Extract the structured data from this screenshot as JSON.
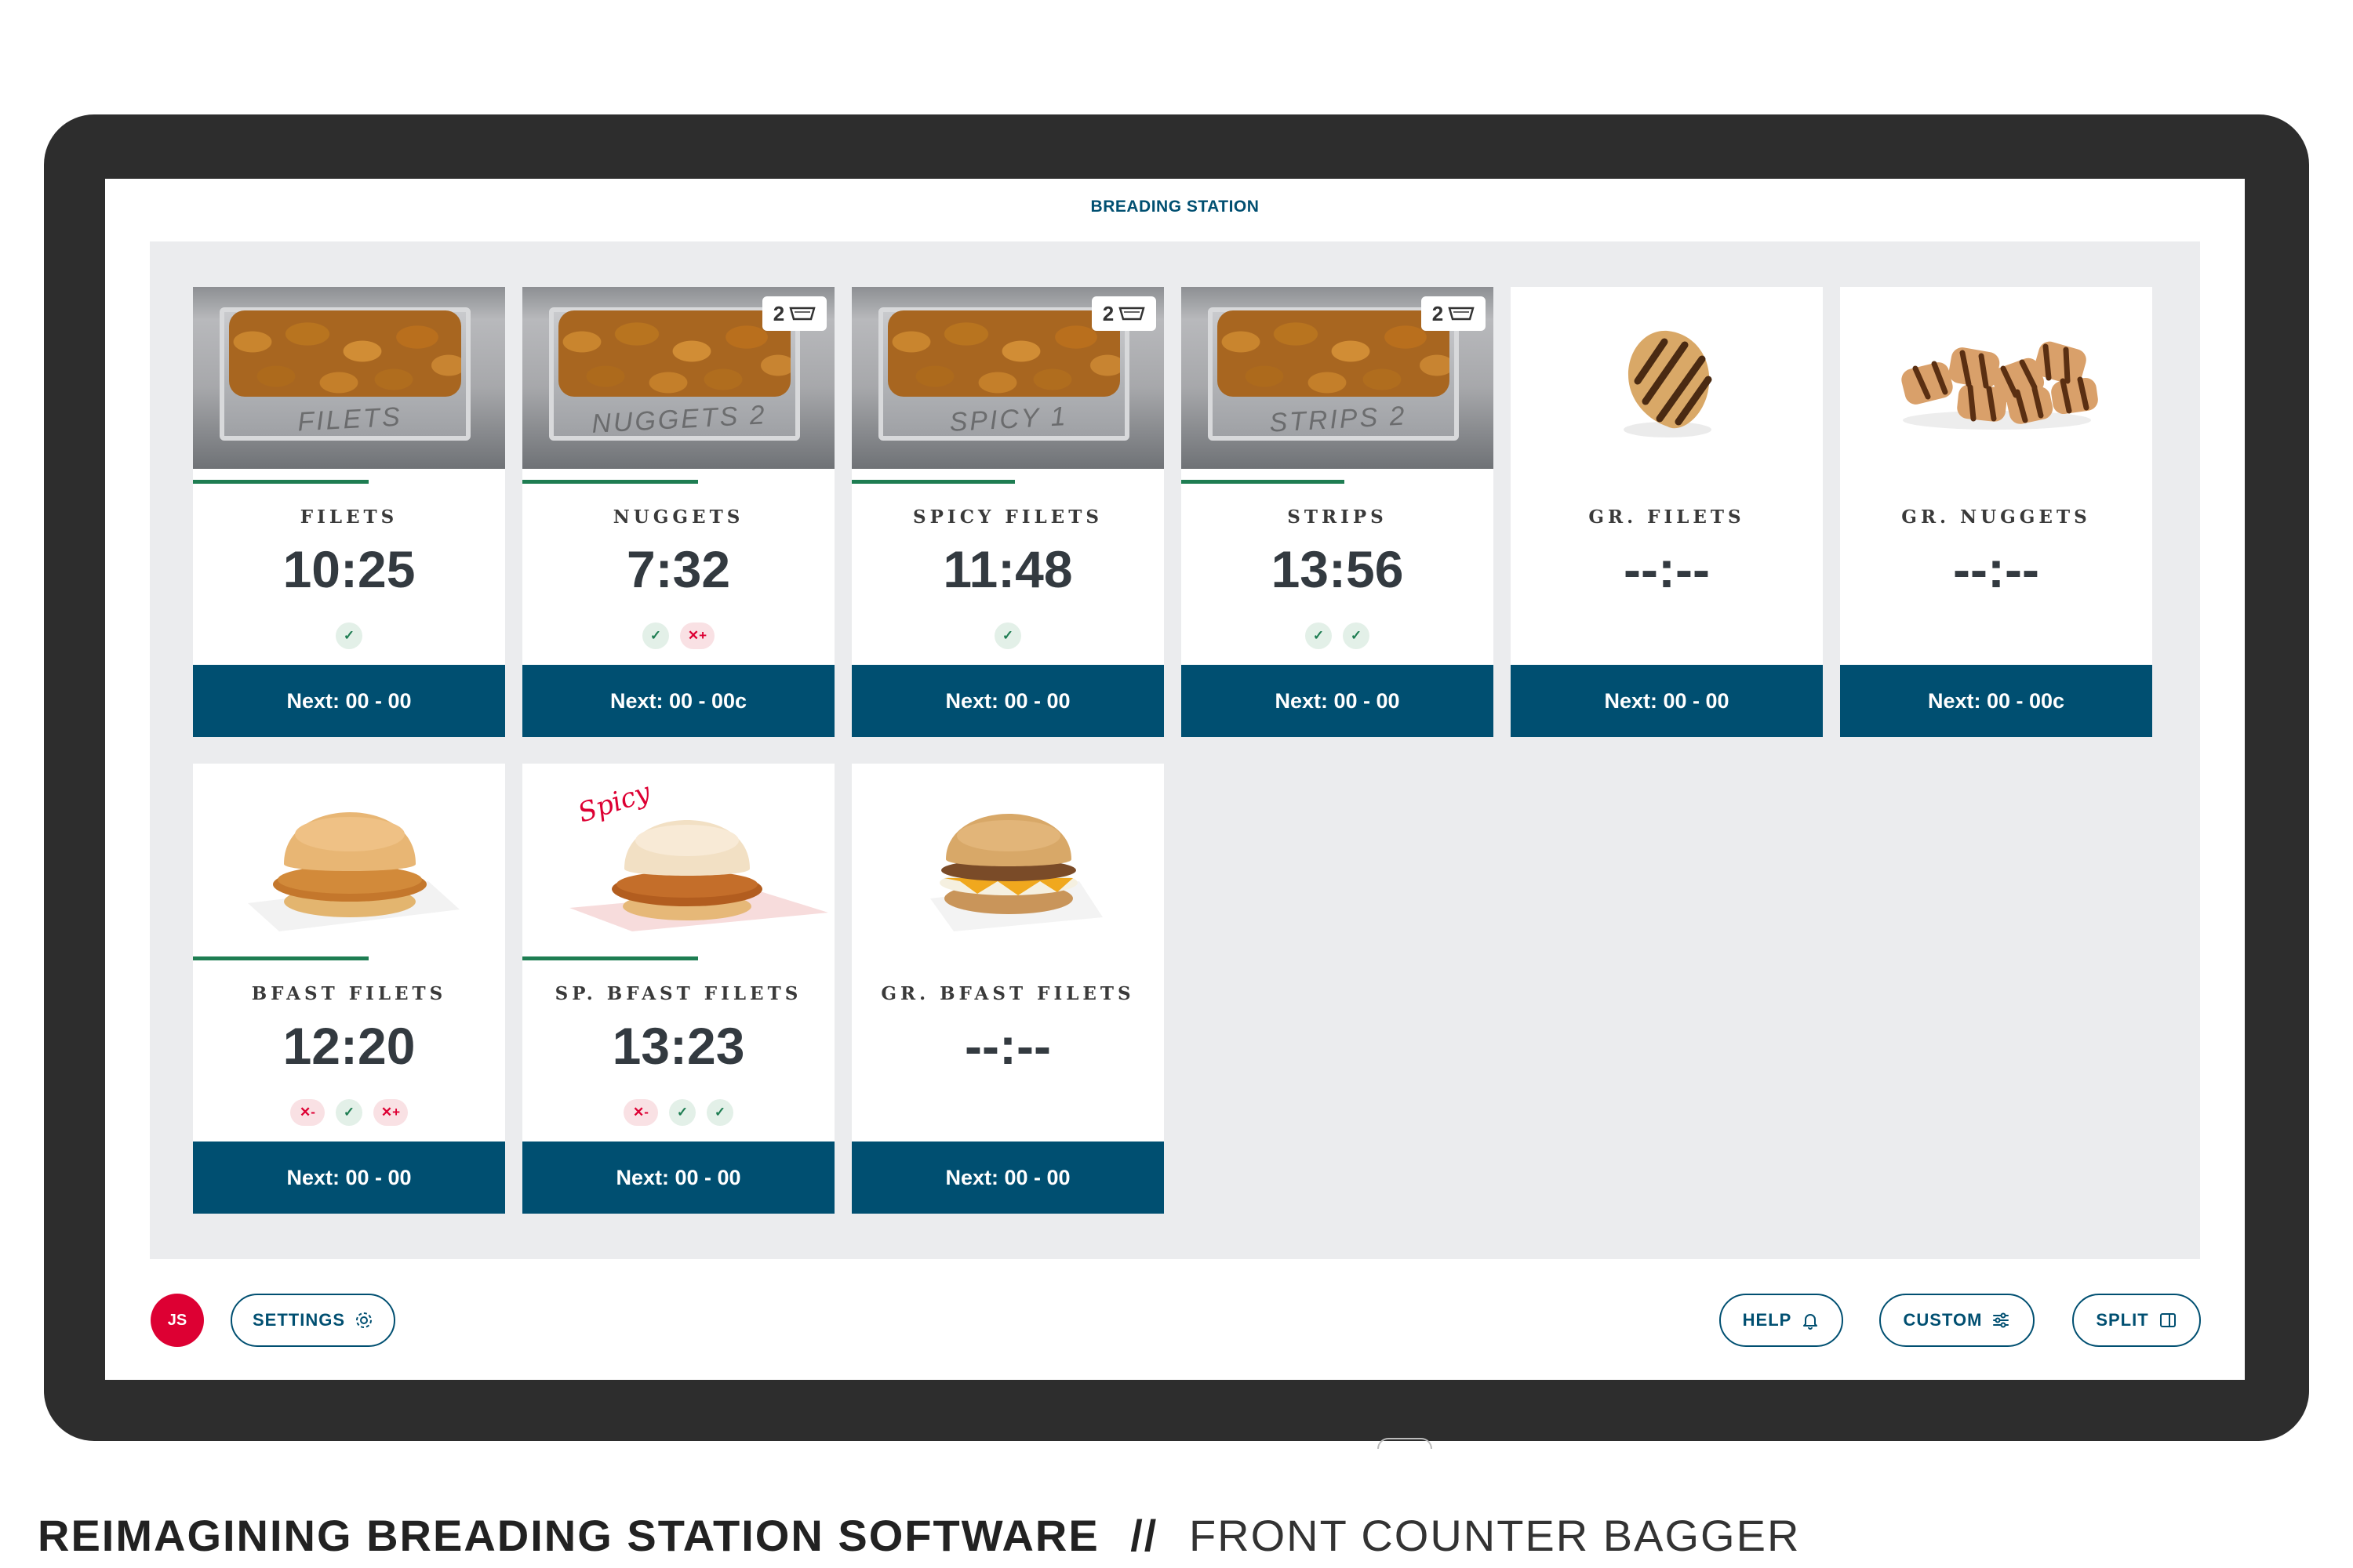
{
  "screen": {
    "title": "BREADING STATION"
  },
  "cards": [
    {
      "name": "FILETS",
      "timer": "10:25",
      "next": "Next: 00 - 00",
      "pan_label": "FILETS",
      "badge": "",
      "progress": 0.56,
      "status": [
        "ok"
      ]
    },
    {
      "name": "NUGGETS",
      "timer": "7:32",
      "next": "Next: 00 - 00c",
      "pan_label": "NUGGETS 2",
      "badge": "2",
      "progress": 0.56,
      "status": [
        "ok",
        "plus"
      ]
    },
    {
      "name": "SPICY FILETS",
      "timer": "11:48",
      "next": "Next: 00 - 00",
      "pan_label": "SPICY 1",
      "badge": "2",
      "progress": 0.52,
      "status": [
        "ok"
      ]
    },
    {
      "name": "STRIPS",
      "timer": "13:56",
      "next": "Next: 00 - 00",
      "pan_label": "STRIPS 2",
      "badge": "2",
      "progress": 0.52,
      "status": [
        "ok",
        "ok"
      ]
    },
    {
      "name": "GR. FILETS",
      "timer": "--:--",
      "next": "Next: 00 - 00",
      "status": []
    },
    {
      "name": "GR. NUGGETS",
      "timer": "--:--",
      "next": "Next: 00 - 00c",
      "status": []
    },
    {
      "name": "BFAST FILETS",
      "timer": "12:20",
      "next": "Next: 00 - 00",
      "progress": 0.56,
      "status": [
        "minus",
        "ok",
        "plus"
      ]
    },
    {
      "name": "SP. BFAST FILETS",
      "timer": "13:23",
      "next": "Next: 00 - 00",
      "progress": 0.56,
      "spicy_script": "Spicy",
      "status": [
        "minus",
        "ok",
        "ok"
      ]
    },
    {
      "name": "GR. BFAST FILETS",
      "timer": "--:--",
      "next": "Next: 00 - 00",
      "status": []
    }
  ],
  "chip_labels": {
    "ok": "✓",
    "minus": "✕-",
    "plus": "✕+"
  },
  "footer": {
    "avatar_initials": "JS",
    "settings_label": "SETTINGS",
    "help_label": "HELP",
    "custom_label": "CUSTOM",
    "split_label": "SPLIT"
  },
  "caption": {
    "bold": "REIMAGINING BREADING STATION SOFTWARE",
    "separator": "//",
    "light": "FRONT COUNTER BAGGER"
  },
  "colors": {
    "navy": "#004f71",
    "green": "#1e7d52",
    "red": "#dd0033",
    "board": "#ebecee"
  }
}
